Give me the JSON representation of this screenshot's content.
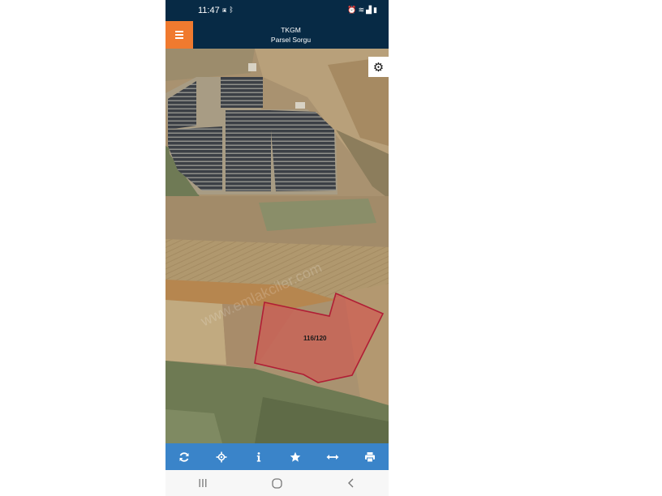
{
  "status_bar": {
    "time": "11:47",
    "left_icons": [
      "image-icon",
      "bluetooth-icon"
    ],
    "right_icons": [
      "alarm-icon",
      "wifi-icon",
      "signal-icon",
      "battery-icon"
    ]
  },
  "header": {
    "title": "TKGM",
    "subtitle": "Parsel Sorgu",
    "menu_icon": "hamburger-menu-icon",
    "accent_color": "#f07a2f",
    "background_color": "#072a45"
  },
  "map": {
    "parcel_label": "116/120",
    "watermark": "www.emlakciler.com",
    "parcel_color": "#c0283c",
    "settings_icon": "gear-icon"
  },
  "toolbar": {
    "background_color": "#3a84c9",
    "items": [
      {
        "icon": "refresh-icon"
      },
      {
        "icon": "locate-crosshair-icon"
      },
      {
        "icon": "info-icon"
      },
      {
        "icon": "star-icon"
      },
      {
        "icon": "measure-arrows-icon"
      },
      {
        "icon": "print-icon"
      }
    ]
  },
  "nav_bar": {
    "items": [
      {
        "icon": "recent-apps-icon"
      },
      {
        "icon": "home-icon"
      },
      {
        "icon": "back-icon"
      }
    ]
  }
}
